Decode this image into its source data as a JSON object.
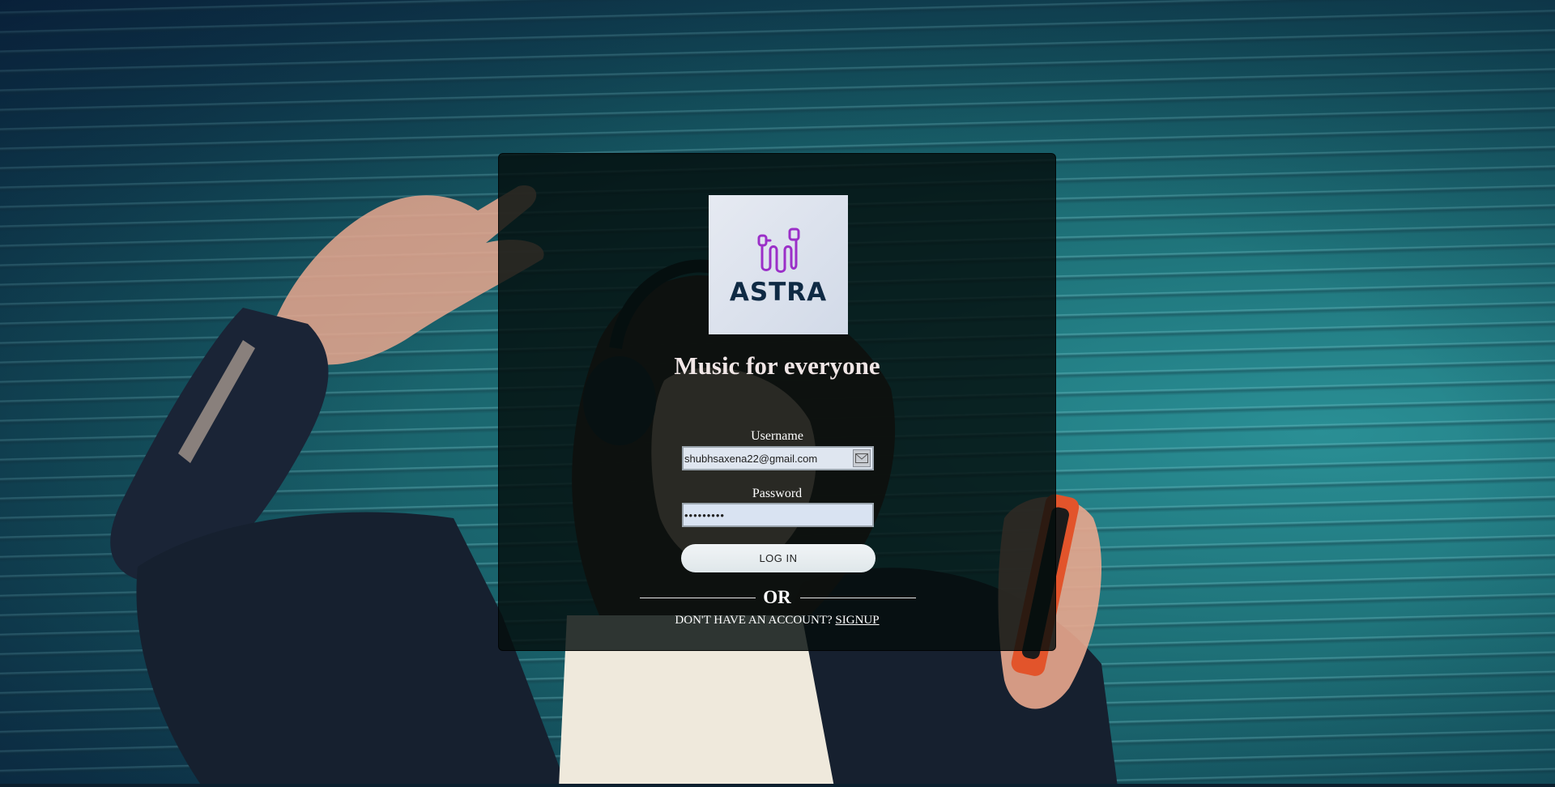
{
  "app": {
    "logo_text": "ASTRA",
    "tagline": "Music for everyone"
  },
  "form": {
    "username_label": "Username",
    "username_value": "shubhsaxena22@gmail.com",
    "password_label": "Password",
    "password_value": "•••••••••",
    "login_label": "LOG IN",
    "or_text": "OR",
    "no_account_text": "DON'T HAVE AN ACCOUNT?",
    "signup_label": "SIGNUP"
  },
  "icons": {
    "logo": "earphones-icon",
    "username_field": "mail-icon"
  },
  "colors": {
    "background_teal": "#1e7178",
    "card_overlay": "#040e0c",
    "logo_text": "#0f2a44",
    "logo_icon": "#9b2fc8"
  }
}
